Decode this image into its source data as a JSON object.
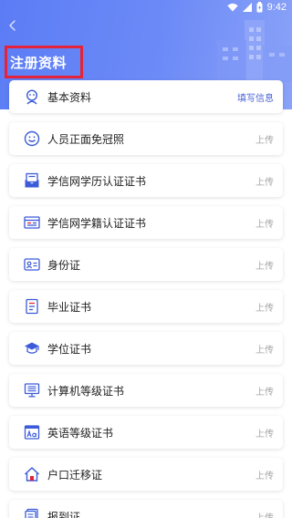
{
  "status_bar": {
    "time": "9:42"
  },
  "header": {
    "title": "注册资料"
  },
  "colors": {
    "header_bg": "#6584f6",
    "accent": "#4a62d6",
    "highlight_border": "#e4233a",
    "icon_primary": "#3b5bd9"
  },
  "items": [
    {
      "label": "基本资料",
      "action": "填写信息",
      "icon": "avatar-outline-icon"
    },
    {
      "label": "人员正面免冠照",
      "action": "上传",
      "icon": "smiley-face-icon"
    },
    {
      "label": "学信网学历认证证书",
      "action": "上传",
      "icon": "certificate-envelope-icon"
    },
    {
      "label": "学信网学籍认证证书",
      "action": "上传",
      "icon": "id-card-lines-icon"
    },
    {
      "label": "身份证",
      "action": "上传",
      "icon": "id-card-icon"
    },
    {
      "label": "毕业证书",
      "action": "上传",
      "icon": "document-icon"
    },
    {
      "label": "学位证书",
      "action": "上传",
      "icon": "graduation-cap-icon"
    },
    {
      "label": "计算机等级证书",
      "action": "上传",
      "icon": "computer-monitor-icon"
    },
    {
      "label": "英语等级证书",
      "action": "上传",
      "icon": "english-aa-icon"
    },
    {
      "label": "户口迁移证",
      "action": "上传",
      "icon": "house-icon"
    },
    {
      "label": "报到证",
      "action": "上传",
      "icon": "report-document-icon"
    }
  ]
}
